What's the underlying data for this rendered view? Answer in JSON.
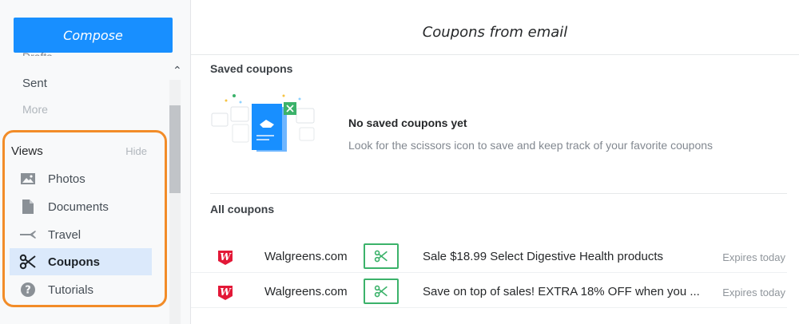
{
  "sidebar": {
    "compose_label": "Compose",
    "partial_folder_label": "Drafts",
    "folders": [
      {
        "label": "Sent"
      },
      {
        "label": "More"
      }
    ],
    "views": {
      "title": "Views",
      "hide_label": "Hide",
      "items": [
        {
          "label": "Photos",
          "icon": "photo-icon"
        },
        {
          "label": "Documents",
          "icon": "document-icon"
        },
        {
          "label": "Travel",
          "icon": "plane-icon"
        },
        {
          "label": "Coupons",
          "icon": "scissors-icon",
          "active": true
        },
        {
          "label": "Tutorials",
          "icon": "help-icon"
        }
      ]
    },
    "highlight_color": "#f28c28"
  },
  "main": {
    "title": "Coupons from email",
    "saved": {
      "heading": "Saved coupons",
      "empty_title": "No saved coupons yet",
      "empty_description": "Look for the scissors icon to save and keep track of your favorite coupons"
    },
    "all": {
      "heading": "All coupons",
      "rows": [
        {
          "merchant": "Walgreens.com",
          "description": "Sale $18.99 Select Digestive Health products",
          "expires": "Expires today"
        },
        {
          "merchant": "Walgreens.com",
          "description": "Save on top of sales! EXTRA 18% OFF when you ...",
          "expires": "Expires today"
        }
      ]
    }
  },
  "colors": {
    "compose_blue": "#188fff",
    "clip_green": "#3bb26a",
    "active_bg": "#dbe9fb",
    "walgreens_red": "#e31837"
  }
}
